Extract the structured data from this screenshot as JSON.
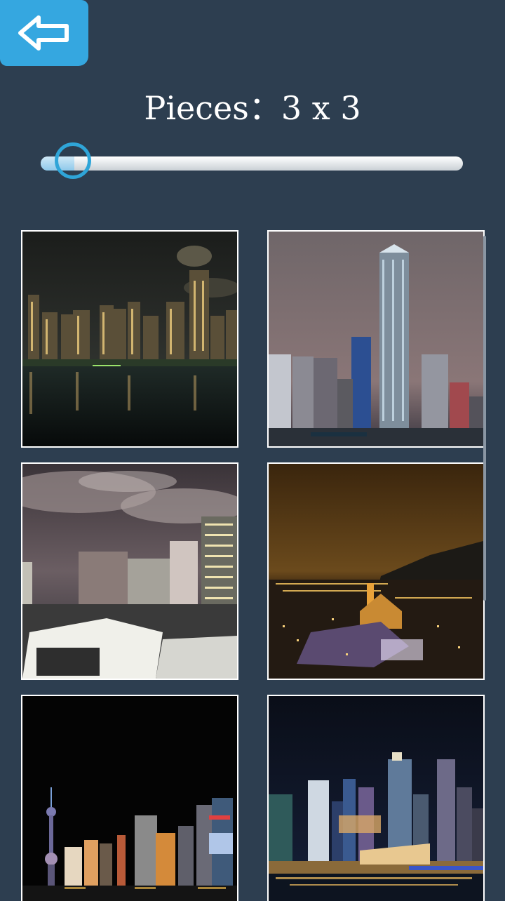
{
  "header": {
    "back_icon": "back-arrow-icon",
    "pieces_label": "Pieces：3 x 3"
  },
  "slider": {
    "value_fraction": 0.04
  },
  "colors": {
    "background": "#2d3e50",
    "accent": "#35a7e0",
    "slider_thumb": "#2fa5d8"
  },
  "gallery": {
    "items": [
      {
        "scene": "city-night-river"
      },
      {
        "scene": "skyscraper-hazy-night"
      },
      {
        "scene": "city-clouds-night"
      },
      {
        "scene": "town-valley-golden-night"
      },
      {
        "scene": "tv-tower-skyline-night"
      },
      {
        "scene": "waterfront-skyline-night"
      }
    ]
  }
}
